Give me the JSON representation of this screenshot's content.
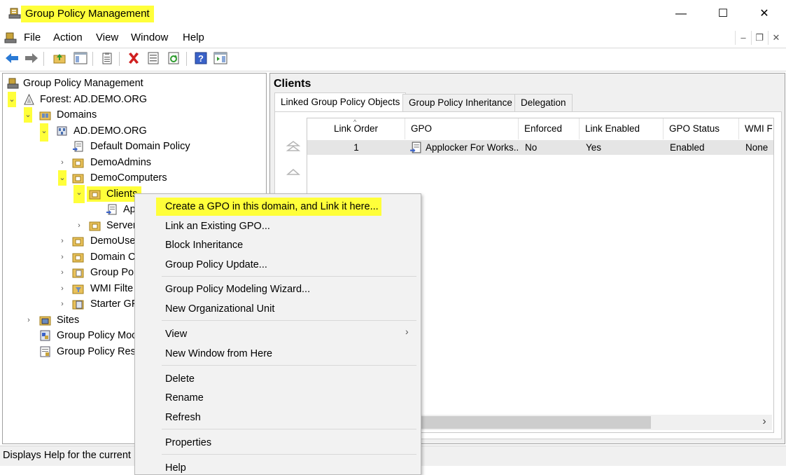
{
  "window": {
    "title": "Group Policy Management",
    "minimize_glyph": "—",
    "maximize_glyph": "☐",
    "close_glyph": "✕"
  },
  "menubar": {
    "items": [
      "File",
      "Action",
      "View",
      "Window",
      "Help"
    ],
    "mdi_minimize_glyph": "–",
    "mdi_restore_glyph": "❐",
    "mdi_close_glyph": "✕"
  },
  "toolbar": {
    "buttons": [
      "back-icon",
      "forward-icon",
      "up-folder-icon",
      "show-hide-tree-icon",
      "properties-icon",
      "delete-icon",
      "export-list-icon",
      "refresh-icon",
      "help-icon",
      "action-pane-icon"
    ]
  },
  "tree": {
    "root": "Group Policy Management",
    "forest": "Forest: AD.DEMO.ORG",
    "domains": "Domains",
    "domain": "AD.DEMO.ORG",
    "default_domain_policy": "Default Domain Policy",
    "demo_admins": "DemoAdmins",
    "demo_computers": "DemoComputers",
    "clients": "Clients",
    "clients_child": "Ap",
    "servers": "Server",
    "demo_users": "DemoUse",
    "domain_controllers": "Domain C",
    "group_policy_objects": "Group Pol",
    "wmi_filters": "WMI Filte",
    "starter_gpos": "Starter GP",
    "sites": "Sites",
    "modeling": "Group Policy Moc",
    "results": "Group Policy Resu"
  },
  "details": {
    "title": "Clients",
    "tabs": [
      "Linked Group Policy Objects",
      "Group Policy Inheritance",
      "Delegation"
    ],
    "active_tab": "Linked Group Policy Objects",
    "columns": [
      "Link Order",
      "GPO",
      "Enforced",
      "Link Enabled",
      "GPO Status",
      "WMI F"
    ],
    "rows": [
      {
        "link_order": "1",
        "gpo": "Applocker For Works...",
        "enforced": "No",
        "link_enabled": "Yes",
        "gpo_status": "Enabled",
        "wmi": "None"
      }
    ],
    "scroll_right_glyph": "›"
  },
  "context_menu": {
    "items": [
      "Create a GPO in this domain, and Link it here...",
      "Link an Existing GPO...",
      "Block Inheritance",
      "Group Policy Update...",
      "Group Policy Modeling Wizard...",
      "New Organizational Unit",
      "View",
      "New Window from Here",
      "Delete",
      "Rename",
      "Refresh",
      "Properties",
      "Help"
    ],
    "submenu_glyph": "›"
  },
  "status": {
    "text": "Displays Help for the current"
  },
  "colors": {
    "highlight": "#ffff3a",
    "selection": "#cce8ff",
    "row_bg": "#e5e5e5",
    "menu_bg": "#f2f2f2"
  }
}
